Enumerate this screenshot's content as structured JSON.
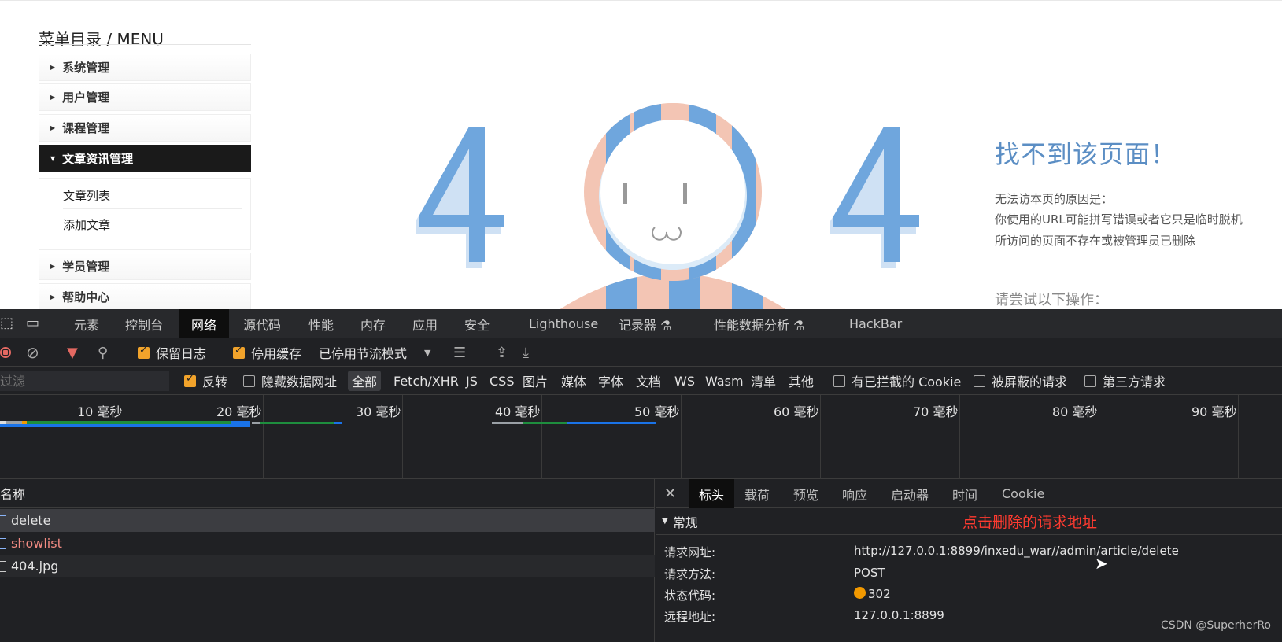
{
  "menu": {
    "title": "菜单目录 / MENU",
    "items": [
      {
        "label": "系统管理"
      },
      {
        "label": "用户管理"
      },
      {
        "label": "课程管理"
      },
      {
        "label": "文章资讯管理"
      },
      {
        "label": "学员管理"
      },
      {
        "label": "帮助中心"
      }
    ],
    "submenu": [
      {
        "label": "文章列表"
      },
      {
        "label": "添加文章"
      }
    ]
  },
  "error_page": {
    "title": "找不到该页面！",
    "reason_heading": "无法访本页的原因是：",
    "reason_1": "你使用的URL可能拼写错误或者它只是临时脱机",
    "reason_2": "所访问的页面不存在或被管理员已删除",
    "try_heading": "请尝试以下操作："
  },
  "devtools": {
    "tabs": [
      "元素",
      "控制台",
      "网络",
      "源代码",
      "性能",
      "内存",
      "应用",
      "安全",
      "Lighthouse",
      "记录器 ⚗",
      "性能数据分析 ⚗",
      "HackBar"
    ],
    "active_tab": "网络",
    "toolbar": {
      "preserve_log": "保留日志",
      "disable_cache": "停用缓存",
      "throttle": "已停用节流模式"
    },
    "filter": {
      "placeholder": "过滤",
      "invert": "反转",
      "hide_data_urls": "隐藏数据网址",
      "types": [
        "全部",
        "Fetch/XHR",
        "JS",
        "CSS",
        "图片",
        "媒体",
        "字体",
        "文档",
        "WS",
        "Wasm",
        "清单",
        "其他"
      ],
      "blocked_cookies": "有已拦截的 Cookie",
      "blocked_requests": "被屏蔽的请求",
      "third_party": "第三方请求"
    },
    "timeline_ticks": [
      "10 毫秒",
      "20 毫秒",
      "30 毫秒",
      "40 毫秒",
      "50 毫秒",
      "60 毫秒",
      "70 毫秒",
      "80 毫秒",
      "90 毫秒"
    ],
    "requests": {
      "header": "名称",
      "rows": [
        {
          "name": "delete"
        },
        {
          "name": "showlist"
        },
        {
          "name": "404.jpg"
        }
      ]
    },
    "detail": {
      "tabs": [
        "标头",
        "载荷",
        "预览",
        "响应",
        "启动器",
        "时间",
        "Cookie"
      ],
      "active_tab": "标头",
      "section": "常规",
      "annotation": "点击删除的请求地址",
      "fields": [
        {
          "key": "请求网址:",
          "value": "http://127.0.0.1:8899/inxedu_war//admin/article/delete"
        },
        {
          "key": "请求方法:",
          "value": "POST"
        },
        {
          "key": "状态代码:",
          "value": "302"
        },
        {
          "key": "远程地址:",
          "value": "127.0.0.1:8899"
        }
      ]
    },
    "colors": {
      "accent": "#f1a32b",
      "status_dot": "#f29900",
      "annotation": "#ff3b30"
    }
  },
  "watermark": "CSDN @SuperherRo"
}
